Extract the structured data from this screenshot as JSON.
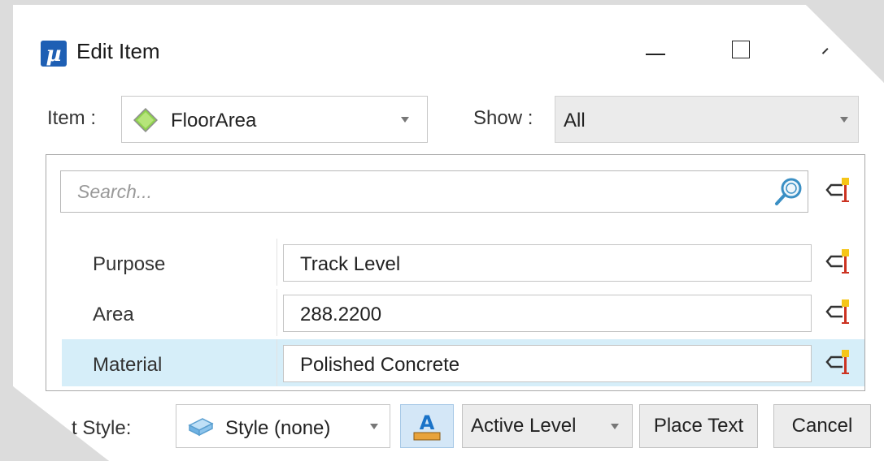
{
  "window": {
    "title": "Edit Item"
  },
  "item": {
    "label": "Item :",
    "value": "FloorArea"
  },
  "show": {
    "label": "Show :",
    "value": "All"
  },
  "search": {
    "placeholder": "Search...",
    "value": ""
  },
  "properties": [
    {
      "name": "Purpose",
      "value": "Track Level"
    },
    {
      "name": "Area",
      "value": "288.2200"
    },
    {
      "name": "Material",
      "value": "Polished Concrete",
      "selected": true
    }
  ],
  "toolbar": {
    "text_style_label": "t Style:",
    "text_style_value": "Style (none)",
    "level_value": "Active Level",
    "place_text_label": "Place Text",
    "cancel_label": "Cancel"
  },
  "icons": {
    "app": "microstation-icon",
    "item_type": "diamond-icon",
    "search": "search-icon",
    "property_action": "property-link-icon",
    "text_style": "text-style-icon",
    "text_color": "text-color-icon"
  },
  "colors": {
    "selected_row": "#d6eef9",
    "accent": "#1a73c8"
  }
}
